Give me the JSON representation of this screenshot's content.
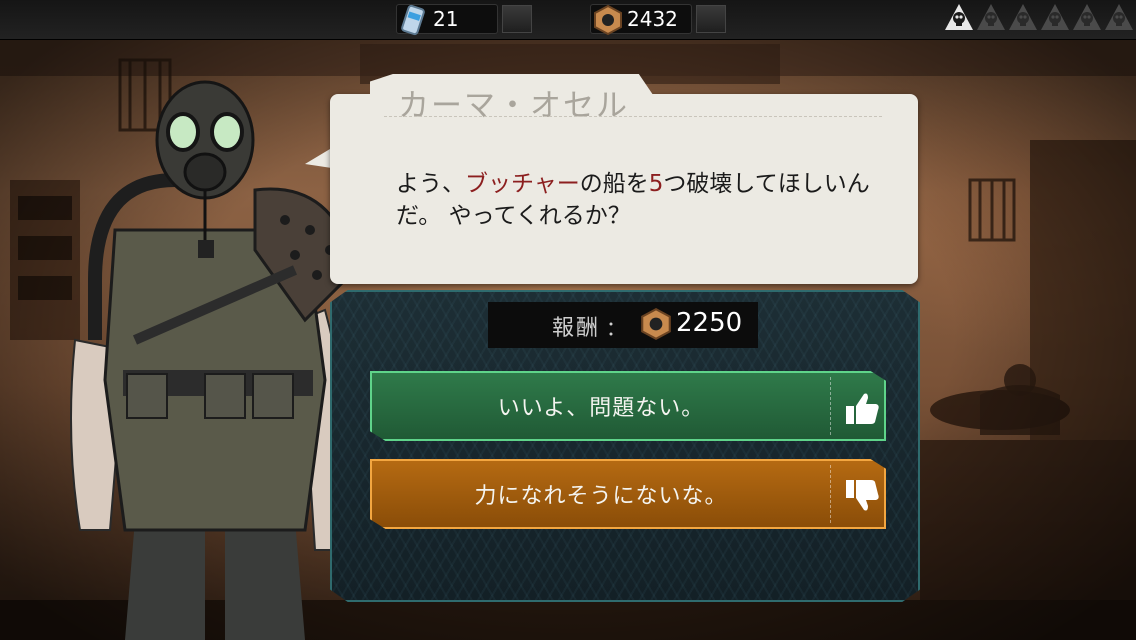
{
  "resources": {
    "fuel": {
      "icon": "fuel-canister-icon",
      "value": "21"
    },
    "nuts": {
      "icon": "hex-nut-icon",
      "value": "2432"
    }
  },
  "threat": {
    "icon": "skull-icon",
    "max": 6,
    "active": 1
  },
  "dialog": {
    "speaker": "カーマ・オセル",
    "text_1": "よう、",
    "target_name": "ブッチャー",
    "text_2": "の船を",
    "count": "5",
    "text_3": "つ破壊してほしいんだ。 やってくれるか？"
  },
  "reward": {
    "label": "報酬",
    "separator": "：",
    "icon": "hex-nut-icon",
    "value": "2250"
  },
  "choices": {
    "accept": {
      "label": "いいよ、問題ない。",
      "icon": "thumbs-up-icon",
      "color": "#2f7a4a"
    },
    "decline": {
      "label": "力になれそうにないな。",
      "icon": "thumbs-down-icon",
      "color": "#b56a12"
    }
  }
}
